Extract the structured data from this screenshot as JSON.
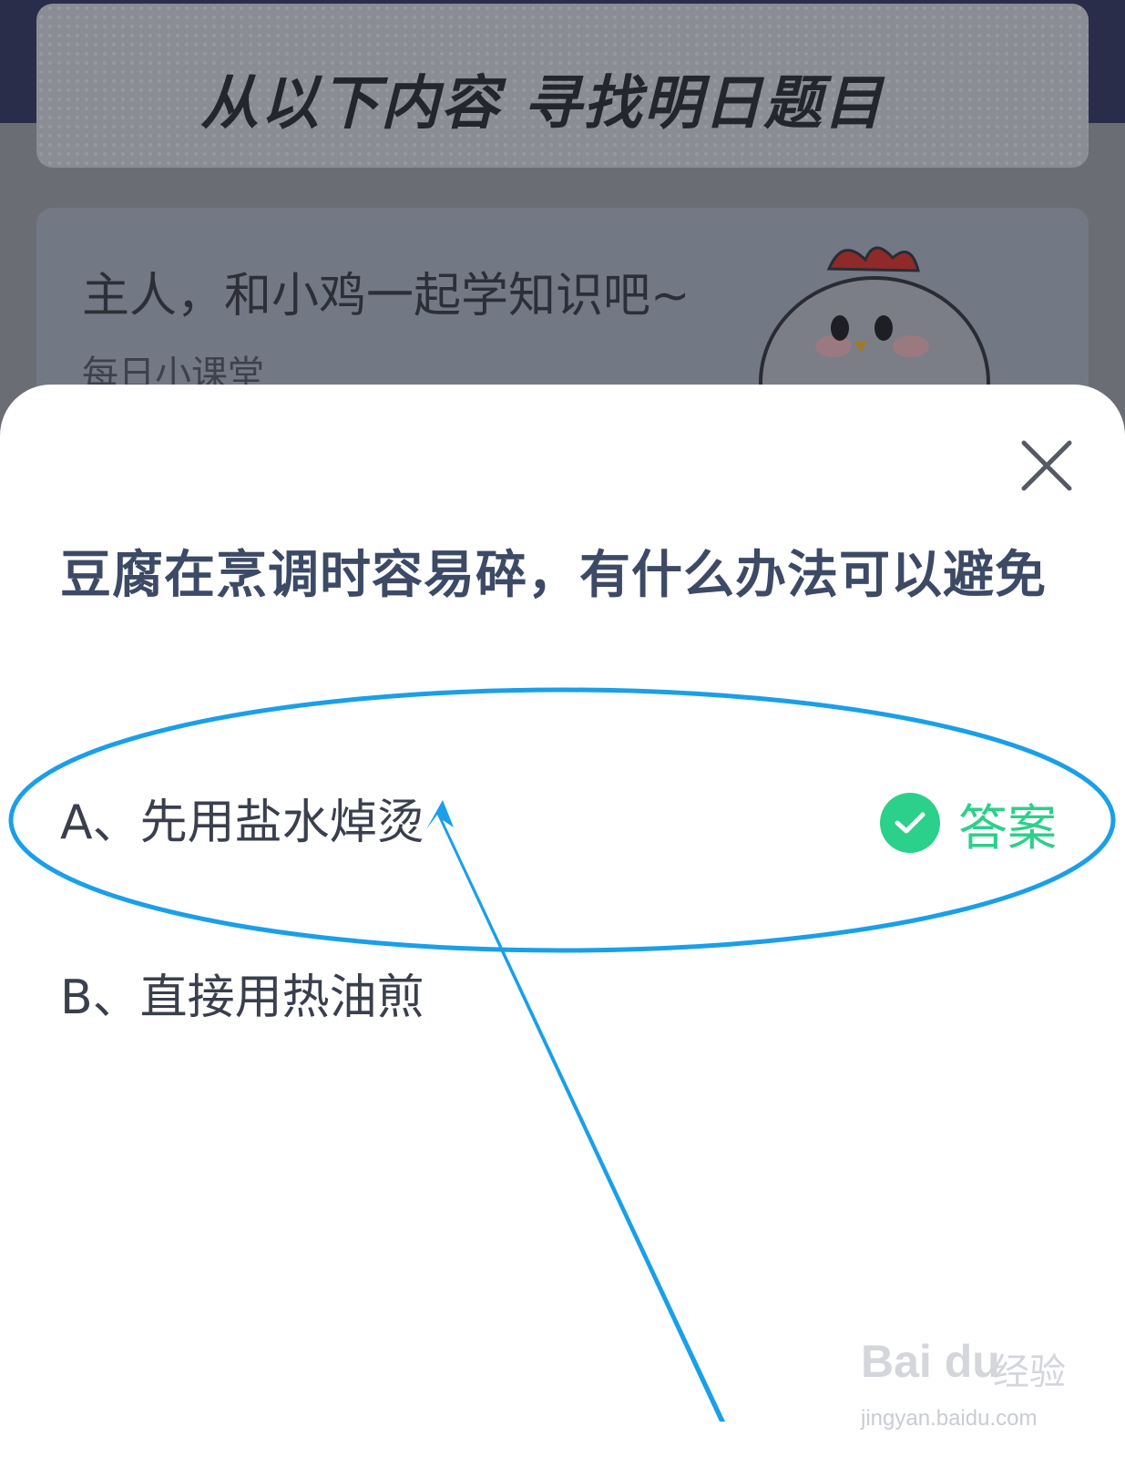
{
  "background": {
    "header_title": "从以下内容  寻找明日题目",
    "lesson_title": "主人，和小鸡一起学知识吧~",
    "lesson_subtitle": "每日小课堂"
  },
  "sheet": {
    "question": "豆腐在烹调时容易碎，有什么办法可以避免",
    "options": [
      {
        "label": "A、先用盐水焯烫",
        "is_answer": true
      },
      {
        "label": "B、直接用热油煎",
        "is_answer": false
      }
    ],
    "answer_label": "答案",
    "close_icon": "close-icon",
    "check_icon": "check-icon",
    "accent_color": "#2bd08a"
  },
  "annotation": {
    "color": "#1a9fe8",
    "shapes": [
      "ellipse",
      "arrow"
    ]
  },
  "watermark": {
    "brand": "Bai du",
    "brand_cn": "经验",
    "url": "jingyan.baidu.com"
  }
}
